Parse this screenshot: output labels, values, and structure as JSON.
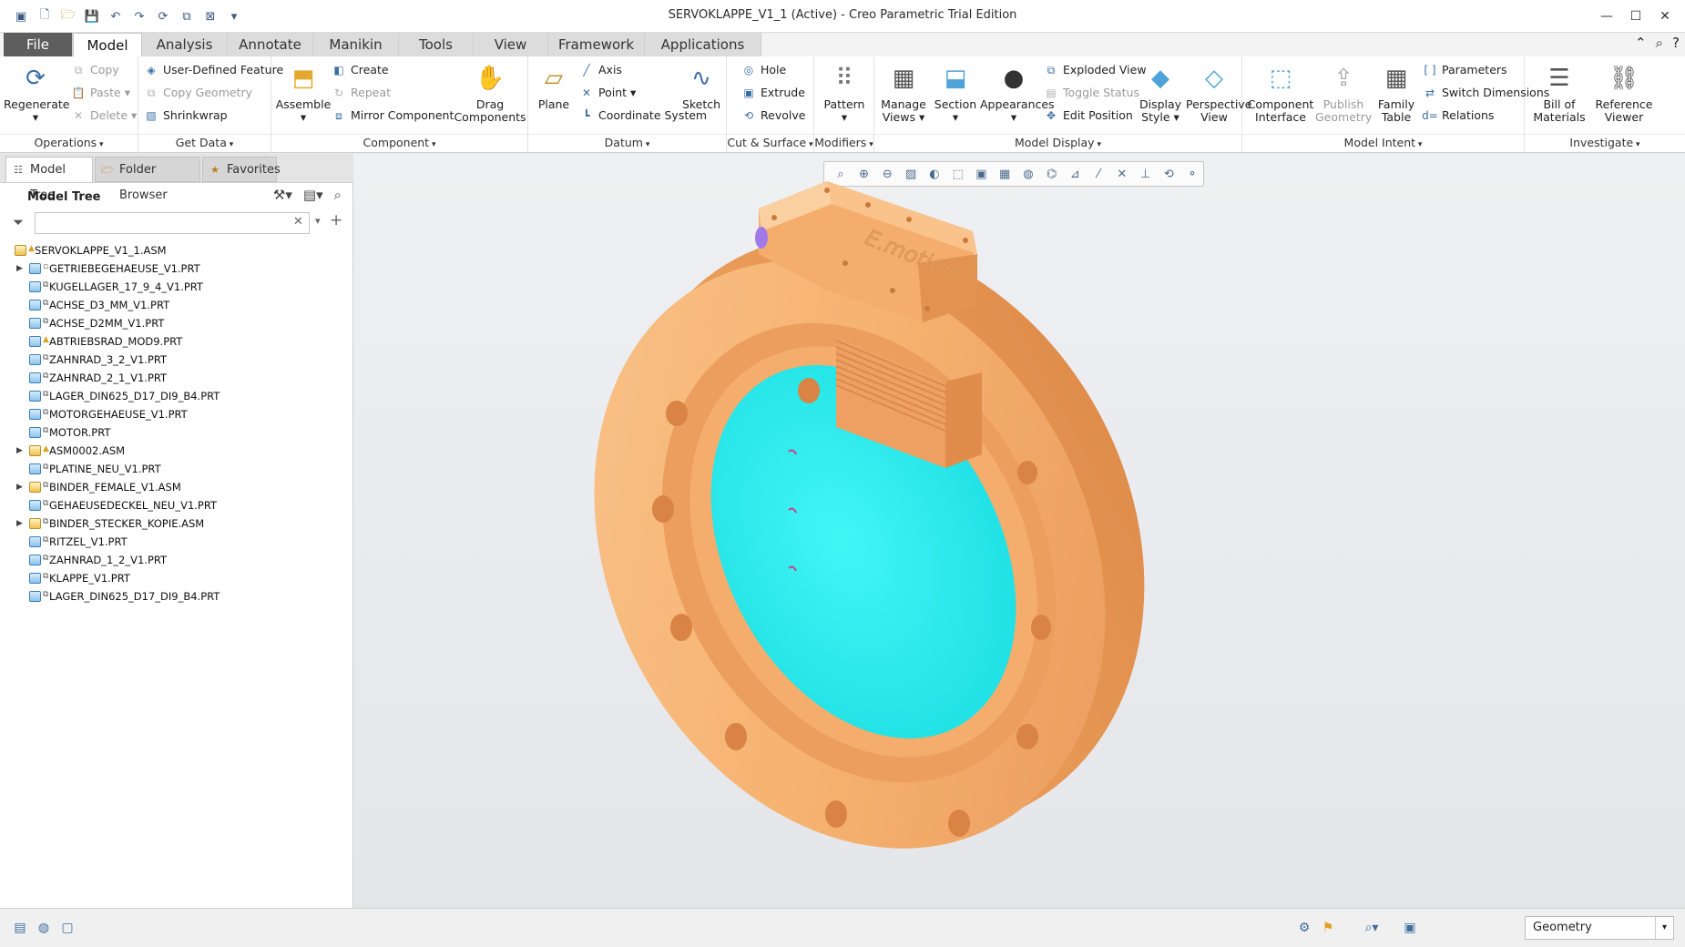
{
  "window": {
    "title": "SERVOKLAPPE_V1_1 (Active) - Creo Parametric Trial Edition"
  },
  "tabs": [
    "File",
    "Model",
    "Analysis",
    "Annotate",
    "Manikin",
    "Tools",
    "View",
    "Framework",
    "Applications"
  ],
  "active_tab": "Model",
  "ribbon": {
    "operations": {
      "label": "Operations",
      "regenerate": "Regenerate",
      "copy": "Copy",
      "paste": "Paste",
      "delete": "Delete"
    },
    "get_data": {
      "label": "Get Data",
      "udf": "User-Defined Feature",
      "copy_geometry": "Copy Geometry",
      "shrinkwrap": "Shrinkwrap"
    },
    "component": {
      "label": "Component",
      "assemble": "Assemble",
      "create": "Create",
      "repeat": "Repeat",
      "mirror": "Mirror Component",
      "drag": "Drag Components"
    },
    "datum": {
      "label": "Datum",
      "plane": "Plane",
      "axis": "Axis",
      "point": "Point",
      "csys": "Coordinate System",
      "sketch": "Sketch"
    },
    "cut_surface": {
      "label": "Cut & Surface",
      "hole": "Hole",
      "extrude": "Extrude",
      "revolve": "Revolve"
    },
    "modifiers": {
      "label": "Modifiers",
      "pattern": "Pattern"
    },
    "model_display": {
      "label": "Model Display",
      "manage_views": "Manage Views",
      "section": "Section",
      "appearances": "Appearances",
      "exploded": "Exploded View",
      "toggle": "Toggle Status",
      "edit_pos": "Edit Position",
      "display_style": "Display Style",
      "perspective": "Perspective View"
    },
    "model_intent": {
      "label": "Model Intent",
      "component_interface": "Component Interface",
      "publish_geometry": "Publish Geometry",
      "family_table": "Family Table",
      "parameters": "Parameters",
      "switch_dims": "Switch Dimensions",
      "relations": "Relations"
    },
    "investigate": {
      "label": "Investigate",
      "bom": "Bill of Materials",
      "ref_viewer": "Reference Viewer"
    }
  },
  "panel": {
    "tabs": [
      "Model Tree",
      "Folder Browser",
      "Favorites"
    ],
    "header": "Model Tree",
    "filter_placeholder": ""
  },
  "tree": [
    {
      "name": "SERVOKLAPPE_V1_1.ASM",
      "type": "asm",
      "level": 0,
      "expand": false,
      "flag": "warn"
    },
    {
      "name": "GETRIEBEGEHAEUSE_V1.PRT",
      "type": "prt",
      "level": 1,
      "expand": true,
      "flag": "box"
    },
    {
      "name": "KUGELLAGER_17_9_4_V1.PRT",
      "type": "prt",
      "level": 1,
      "expand": false,
      "flag": "pkg"
    },
    {
      "name": "ACHSE_D3_MM_V1.PRT",
      "type": "prt",
      "level": 1,
      "expand": false,
      "flag": "pkg"
    },
    {
      "name": "ACHSE_D2MM_V1.PRT",
      "type": "prt",
      "level": 1,
      "expand": false,
      "flag": "pkg"
    },
    {
      "name": "ABTRIEBSRAD_MOD9.PRT",
      "type": "prt",
      "level": 1,
      "expand": false,
      "flag": "warn"
    },
    {
      "name": "ZAHNRAD_3_2_V1.PRT",
      "type": "prt",
      "level": 1,
      "expand": false,
      "flag": "pkg"
    },
    {
      "name": "ZAHNRAD_2_1_V1.PRT",
      "type": "prt",
      "level": 1,
      "expand": false,
      "flag": "pkg"
    },
    {
      "name": "LAGER_DIN625_D17_DI9_B4.PRT",
      "type": "prt",
      "level": 1,
      "expand": false,
      "flag": "pkg"
    },
    {
      "name": "MOTORGEHAEUSE_V1.PRT",
      "type": "prt",
      "level": 1,
      "expand": false,
      "flag": "pkg"
    },
    {
      "name": "MOTOR.PRT",
      "type": "prt",
      "level": 1,
      "expand": false,
      "flag": "pkg"
    },
    {
      "name": "ASM0002.ASM",
      "type": "asm",
      "level": 1,
      "expand": true,
      "flag": "warn"
    },
    {
      "name": "PLATINE_NEU_V1.PRT",
      "type": "prt",
      "level": 1,
      "expand": false,
      "flag": "pkg"
    },
    {
      "name": "BINDER_FEMALE_V1.ASM",
      "type": "asm",
      "level": 1,
      "expand": true,
      "flag": "pkg"
    },
    {
      "name": "GEHAEUSEDECKEL_NEU_V1.PRT",
      "type": "prt",
      "level": 1,
      "expand": false,
      "flag": "pkg"
    },
    {
      "name": "BINDER_STECKER_KOPIE.ASM",
      "type": "asm",
      "level": 1,
      "expand": true,
      "flag": "pkg"
    },
    {
      "name": "RITZEL_V1.PRT",
      "type": "prt",
      "level": 1,
      "expand": false,
      "flag": "pkg"
    },
    {
      "name": "ZAHNRAD_1_2_V1.PRT",
      "type": "prt",
      "level": 1,
      "expand": false,
      "flag": "pkg"
    },
    {
      "name": "KLAPPE_V1.PRT",
      "type": "prt",
      "level": 1,
      "expand": false,
      "flag": "pkg"
    },
    {
      "name": "LAGER_DIN625_D17_DI9_B4.PRT",
      "type": "prt",
      "level": 1,
      "expand": false,
      "flag": "pkg"
    }
  ],
  "model_text": "E.motion",
  "status": {
    "filter_select": "Geometry"
  },
  "colors": {
    "body": "#f7b675",
    "disc": "#2ef0f0",
    "background": "#e8eaee"
  }
}
